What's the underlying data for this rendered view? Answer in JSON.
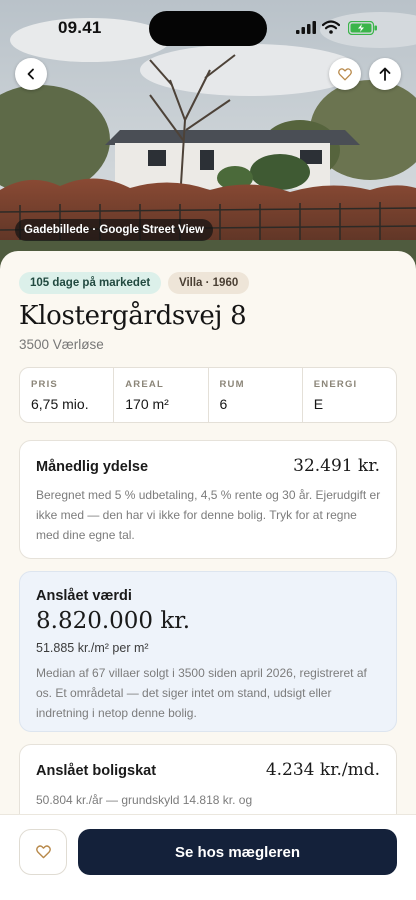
{
  "status_bar": {
    "time": "09.41"
  },
  "hero": {
    "caption": "Gadebillede · Google Street View"
  },
  "listing": {
    "chips": {
      "market": "105 dage på markedet",
      "type": "Villa · 1960"
    },
    "address": "Klostergårdsvej 8",
    "city": "3500 Værløse",
    "facts": [
      {
        "label": "PRIS",
        "value": "6,75 mio."
      },
      {
        "label": "AREAL",
        "value": "170 m²"
      },
      {
        "label": "RUM",
        "value": "6"
      },
      {
        "label": "ENERGI",
        "value": "E"
      }
    ]
  },
  "monthly": {
    "title": "Månedlig ydelse",
    "amount": "32.491 kr.",
    "note": "Beregnet med 5 % udbetaling, 4,5 % rente og 30 år. Ejerudgift er ikke med — den har vi ikke for denne bolig. Tryk for at regne med dine egne tal."
  },
  "estimate": {
    "title": "Anslået værdi",
    "amount": "8.820.000 kr.",
    "per_sqm": "51.885 kr./m² per m²",
    "note": "Median af 67 villaer solgt i 3500 siden april 2026, registreret af os. Et områdetal — det siger intet om stand, udsigt eller indretning i netop denne bolig."
  },
  "tax": {
    "title": "Anslået boligskat",
    "amount": "4.234 kr./md.",
    "note": "50.804 kr./år — grundskyld 14.818 kr. og"
  },
  "bottom_bar": {
    "cta_label": "Se hos mægleren"
  },
  "colors": {
    "cta": "#14213a",
    "market_chip": "#dcf0ea",
    "estimate_card": "#eef3fa",
    "heart": "#b8894a"
  },
  "icons": [
    "back-arrow-icon",
    "heart-icon",
    "share-arrow-icon",
    "signal-icon",
    "wifi-icon",
    "battery-icon"
  ]
}
